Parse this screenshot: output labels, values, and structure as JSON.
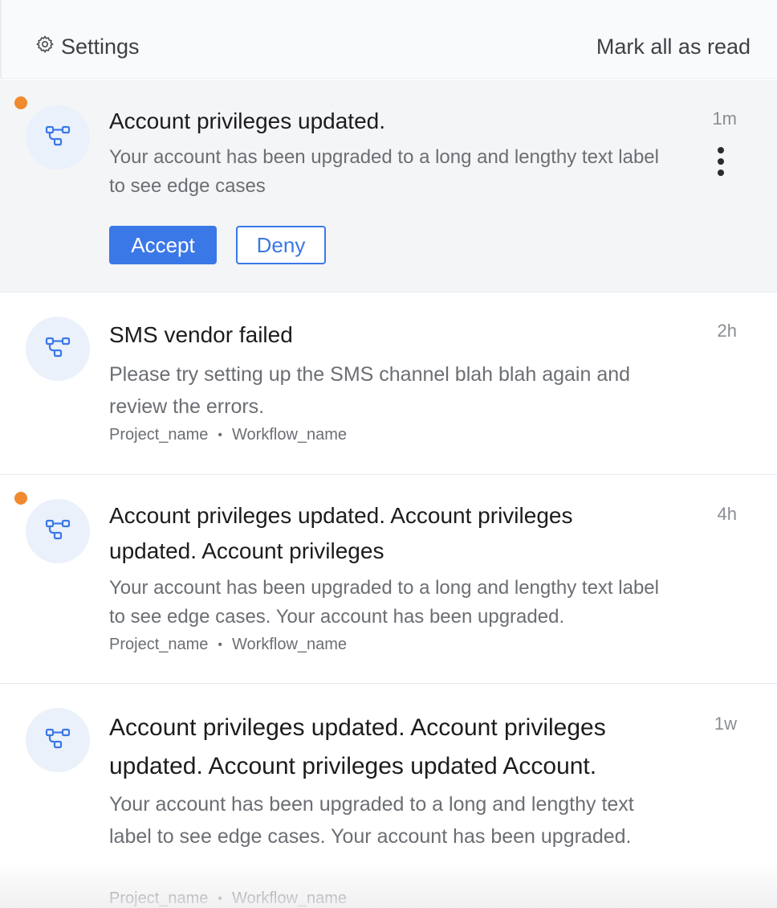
{
  "header": {
    "settings_label": "Settings",
    "mark_all_read_label": "Mark all as read"
  },
  "accent_color": "#3b78e7",
  "unread_dot_color": "#f08a2f",
  "notifications": [
    {
      "unread": true,
      "icon": "workflow-icon",
      "title": "Account privileges updated.",
      "body": "Your account has been upgraded to a long and lengthy text label to see edge cases",
      "time": "1m",
      "actions": {
        "accept": "Accept",
        "deny": "Deny"
      }
    },
    {
      "unread": false,
      "icon": "workflow-icon",
      "title": "SMS vendor failed",
      "body": "Please try setting up the SMS channel blah blah again and review the errors.",
      "time": "2h",
      "project": "Project_name",
      "separator": "•",
      "workflow": "Workflow_name"
    },
    {
      "unread": true,
      "icon": "workflow-icon",
      "title": "Account privileges updated. Account privileges updated. Account privileges",
      "body": "Your account has been upgraded to a long and lengthy text label to see edge cases. Your account has been upgraded.",
      "time": "4h",
      "project": "Project_name",
      "separator": "•",
      "workflow": "Workflow_name"
    },
    {
      "unread": false,
      "icon": "workflow-icon",
      "title": "Account privileges updated. Account privileges updated. Account privileges updated Account.",
      "body": "Your account has been upgraded to a long and lengthy text label to see edge cases. Your account has been upgraded.",
      "time": "1w",
      "project": "Project_name",
      "separator": "•",
      "workflow": "Workflow_name"
    }
  ]
}
